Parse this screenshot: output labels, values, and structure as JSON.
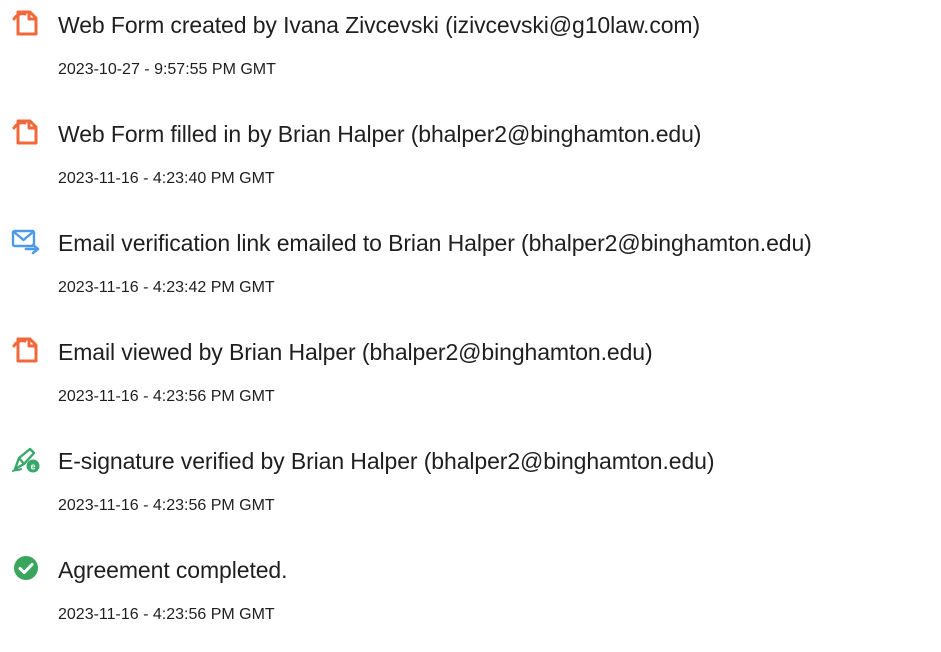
{
  "colors": {
    "document_icon": "#F2683A",
    "email_icon": "#4D9BE6",
    "signature_icon": "#38A86A",
    "complete_icon": "#3AA55C"
  },
  "events": [
    {
      "icon": "document-icon",
      "text": "Web Form created by Ivana Zivcevski (izivcevski@g10law.com)",
      "timestamp": "2023-10-27 - 9:57:55 PM GMT"
    },
    {
      "icon": "document-icon",
      "text": "Web Form filled in by Brian Halper (bhalper2@binghamton.edu)",
      "timestamp": "2023-11-16 - 4:23:40 PM GMT"
    },
    {
      "icon": "email-send-icon",
      "text": "Email verification link emailed to Brian Halper (bhalper2@binghamton.edu)",
      "timestamp": "2023-11-16 - 4:23:42 PM GMT"
    },
    {
      "icon": "document-icon",
      "text": "Email viewed by Brian Halper (bhalper2@binghamton.edu)",
      "timestamp": "2023-11-16 - 4:23:56 PM GMT"
    },
    {
      "icon": "e-signature-icon",
      "text": "E-signature verified by Brian Halper (bhalper2@binghamton.edu)",
      "timestamp": "2023-11-16 - 4:23:56 PM GMT"
    },
    {
      "icon": "checkmark-circle-icon",
      "text": "Agreement completed.",
      "timestamp": "2023-11-16 - 4:23:56 PM GMT"
    }
  ]
}
